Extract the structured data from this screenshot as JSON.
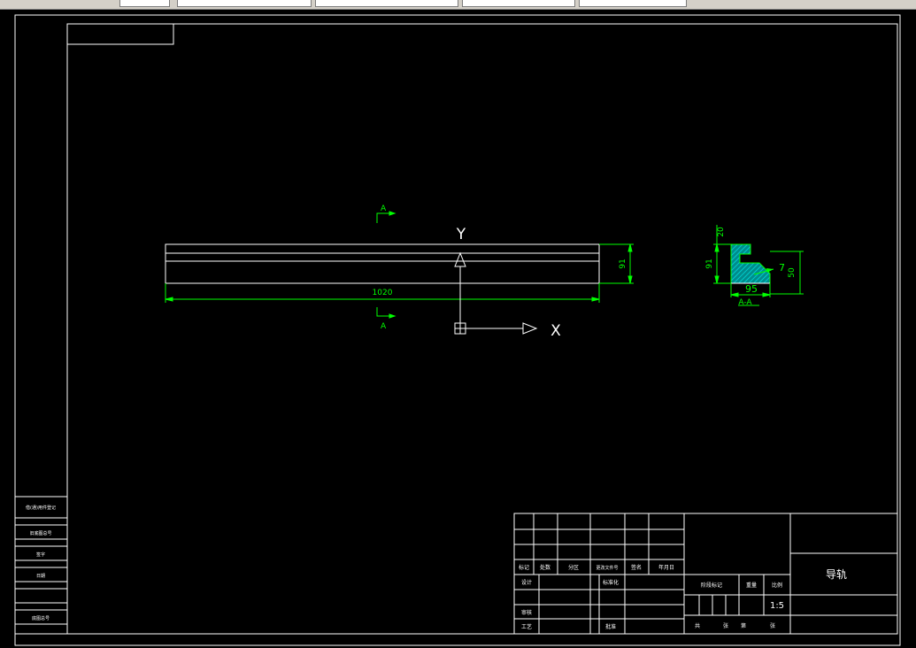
{
  "drawing": {
    "part_name": "导轨",
    "scale": "1:5",
    "section_label": "A-A",
    "cut_label": "A",
    "ucs_x": "X",
    "ucs_y": "Y"
  },
  "dimensions": {
    "length": "1020",
    "height_front": "91",
    "section_height": "91",
    "section_top": "20",
    "section_width": "95",
    "section_right": "50",
    "section_angle": "7"
  },
  "colors": {
    "background": "#000000",
    "lines": "#ffffff",
    "dimension": "#00ff00",
    "hatch": "#00c8c8"
  },
  "title_block": {
    "row_labels": [
      "标记",
      "处数",
      "分区",
      "更改文件号",
      "签名",
      "年月日"
    ],
    "design": "设计",
    "standardize": "标准化",
    "review": "审核",
    "process": "工艺",
    "approve": "批准",
    "stage_mark": "阶段标记",
    "weight": "重量",
    "scale_label": "比例",
    "sheet_total": "共",
    "sheet_page": "张",
    "sheet_no": "第"
  },
  "left_strip": {
    "borrow_reg": "借(通)用件登记",
    "old_drawing": "旧底图总号",
    "sign": "签字",
    "date": "日期",
    "bottom": "底图总号"
  }
}
